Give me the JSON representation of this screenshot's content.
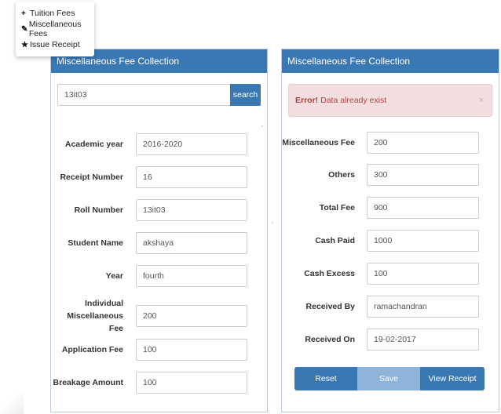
{
  "menu": {
    "items": [
      {
        "icon": "+",
        "label": "Tuition Fees"
      },
      {
        "icon": "✎",
        "label": "Miscellaneous Fees"
      },
      {
        "icon": "★",
        "label": "Issue Receipt"
      }
    ]
  },
  "left": {
    "title": "Miscellaneous Fee Collection",
    "search_value": "13it03",
    "search_button": "search",
    "fields": [
      {
        "label": "Academic year",
        "value": "2016-2020"
      },
      {
        "label": "Receipt Number",
        "value": "16"
      },
      {
        "label": "Roll Number",
        "value": "13it03"
      },
      {
        "label": "Student Name",
        "value": "akshaya"
      },
      {
        "label": "Year",
        "value": "fourth"
      },
      {
        "label": "Individual Miscellaneous Fee",
        "value": "200"
      },
      {
        "label": "Application Fee",
        "value": "100"
      },
      {
        "label": "Breakage Amount",
        "value": "100"
      }
    ]
  },
  "right": {
    "title": "Miscellaneous Fee Collection",
    "alert_strong": "Error!",
    "alert_text": " Data already exist",
    "alert_close": "×",
    "fields": [
      {
        "label": "Miscellaneous Fee",
        "value": "200"
      },
      {
        "label": "Others",
        "value": "300"
      },
      {
        "label": "Total Fee",
        "value": "900"
      },
      {
        "label": "Cash Paid",
        "value": "1000"
      },
      {
        "label": "Cash Excess",
        "value": "100"
      },
      {
        "label": "Received By",
        "value": "ramachandran"
      },
      {
        "label": "Received On",
        "value": "19-02-2017"
      }
    ],
    "buttons": {
      "reset": "Reset",
      "save": "Save",
      "view": "View Receipt"
    }
  },
  "colors": {
    "primary": "#3a78b4",
    "save_light": "#8eb5d9",
    "alert_bg": "#f2dede",
    "alert_text": "#a94442"
  }
}
